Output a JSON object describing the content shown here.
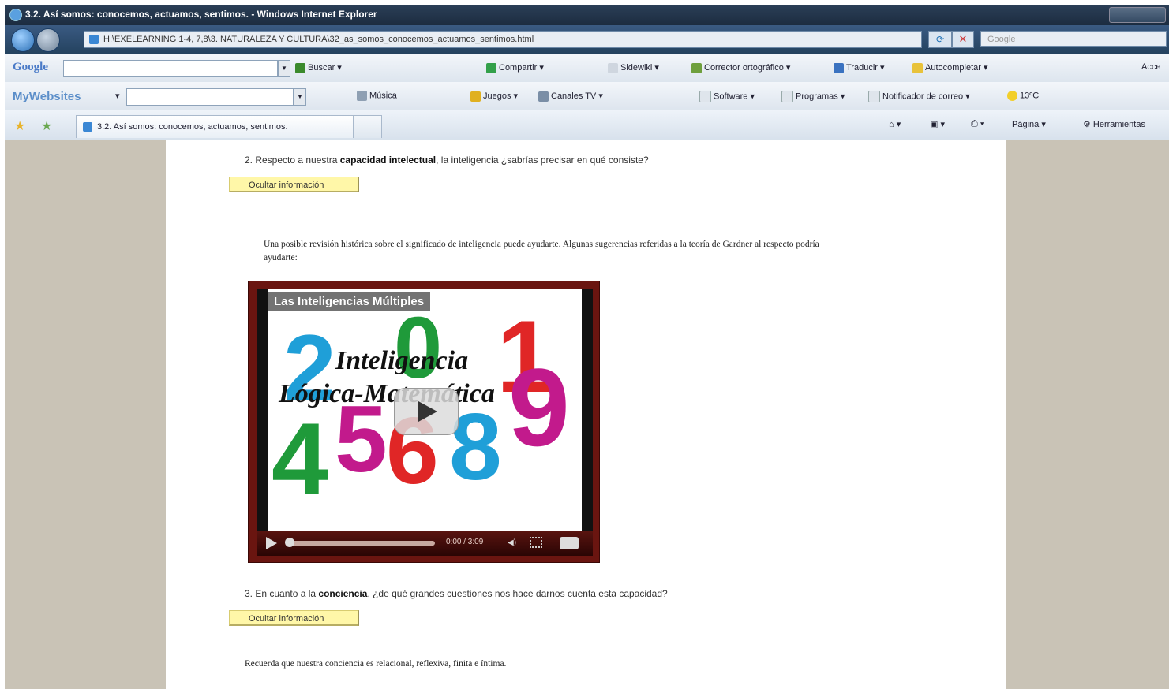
{
  "window": {
    "title": "3.2. Así somos: conocemos, actuamos, sentimos. - Windows Internet Explorer"
  },
  "address_bar": {
    "url": "H:\\EXELEARNING 1-4, 7,8\\3. NATURALEZA Y CULTURA\\32_as_somos_conocemos_actuamos_sentimos.html",
    "search_placeholder": "Google"
  },
  "google_toolbar": {
    "logo": "Google",
    "items": [
      "Buscar",
      "Compartir",
      "Sidewiki",
      "Corrector ortográfico",
      "Traducir",
      "Autocompletar",
      "Acce"
    ]
  },
  "mywebsites_toolbar": {
    "logo": "MyWebsites",
    "items": [
      "Música",
      "Juegos",
      "Canales TV",
      "Software",
      "Programas",
      "Notificador de correo",
      "13ºC"
    ]
  },
  "tabs_bar": {
    "tab_title": "3.2. Así somos: conocemos, actuamos, sentimos.",
    "right_items": [
      "Página",
      "Herramientas"
    ]
  },
  "content": {
    "q2_prefix": "2. Respecto a nuestra ",
    "q2_bold": "capacidad intelectual",
    "q2_suffix": ", la inteligencia ¿sabrías precisar en qué consiste?",
    "hide_button_1": "Ocultar información",
    "hint_1": "Una posible revisión histórica sobre el significado de inteligencia puede ayudarte. Algunas sugerencias referidas a la teoría de Gardner al respecto podría",
    "hint_1_cont": "ayudarte:",
    "q3_prefix": "3. En cuanto a la ",
    "q3_bold": "conciencia",
    "q3_suffix": ", ¿de qué grandes cuestiones nos hace darnos cuenta esta capacidad?",
    "hide_button_2": "Ocultar información",
    "hint_2": "Recuerda que nuestra conciencia es relacional, reflexiva, finita e íntima."
  },
  "video": {
    "overlay_title": "Las Inteligencias Múltiples",
    "line1": "Inteligencia",
    "line2": "Lógica-Matemática",
    "time": "0:00 / 3:09",
    "digits": [
      {
        "d": "2",
        "color": "#1f9fd8"
      },
      {
        "d": "1",
        "color": "#e02626"
      },
      {
        "d": "4",
        "color": "#1f9a3a"
      },
      {
        "d": "5",
        "color": "#c21a8c"
      },
      {
        "d": "6",
        "color": "#e02626"
      },
      {
        "d": "8",
        "color": "#1f9fd8"
      },
      {
        "d": "9",
        "color": "#c21a8c"
      },
      {
        "d": "0",
        "color": "#1f9a3a"
      }
    ]
  }
}
